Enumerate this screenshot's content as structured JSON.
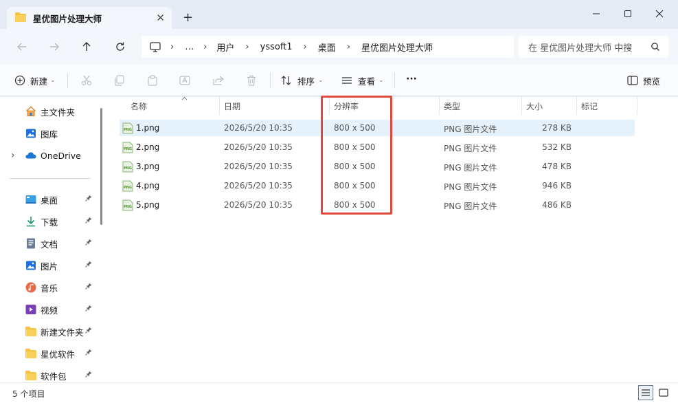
{
  "window": {
    "tab_title": "星优图片处理大师",
    "tab_close": "✕",
    "new_tab": "+"
  },
  "address": {
    "crumbs": [
      "…",
      "用户",
      "yssoft1",
      "桌面",
      "星优图片处理大师"
    ],
    "separator": "›"
  },
  "search": {
    "placeholder": "在 星优图片处理大师 中搜"
  },
  "toolbar": {
    "new_label": "新建",
    "sort_label": "排序",
    "view_label": "查看",
    "more_label": "···",
    "preview_label": "预览",
    "caret": "⌄"
  },
  "sidebar": {
    "top_items": [
      {
        "label": "主文件夹",
        "icon": "home-icon"
      },
      {
        "label": "图库",
        "icon": "gallery-icon"
      },
      {
        "label": "OneDrive",
        "icon": "onedrive-icon"
      }
    ],
    "pinned_items": [
      {
        "label": "桌面",
        "icon": "desktop-icon"
      },
      {
        "label": "下载",
        "icon": "download-icon"
      },
      {
        "label": "文档",
        "icon": "document-icon"
      },
      {
        "label": "图片",
        "icon": "pictures-icon"
      },
      {
        "label": "音乐",
        "icon": "music-icon"
      },
      {
        "label": "视频",
        "icon": "video-icon"
      },
      {
        "label": "新建文件夹",
        "icon": "folder-icon"
      },
      {
        "label": "星优软件",
        "icon": "folder-icon"
      },
      {
        "label": "软件包",
        "icon": "folder-icon"
      }
    ],
    "expand_glyph": "›",
    "pin_glyph": "📌"
  },
  "columns": {
    "name": "名称",
    "date": "日期",
    "resolution": "分辨率",
    "type": "类型",
    "size": "大小",
    "tags": "标记"
  },
  "files": [
    {
      "name": "1.png",
      "date": "2026/5/20 10:35",
      "resolution": "800 x 500",
      "type": "PNG 图片文件",
      "size": "278 KB"
    },
    {
      "name": "2.png",
      "date": "2026/5/20 10:35",
      "resolution": "800 x 500",
      "type": "PNG 图片文件",
      "size": "532 KB"
    },
    {
      "name": "3.png",
      "date": "2026/5/20 10:35",
      "resolution": "800 x 500",
      "type": "PNG 图片文件",
      "size": "478 KB"
    },
    {
      "name": "4.png",
      "date": "2026/5/20 10:35",
      "resolution": "800 x 500",
      "type": "PNG 图片文件",
      "size": "946 KB"
    },
    {
      "name": "5.png",
      "date": "2026/5/20 10:35",
      "resolution": "800 x 500",
      "type": "PNG 图片文件",
      "size": "486 KB"
    }
  ],
  "status": {
    "item_count": "5 个项目"
  },
  "colors": {
    "highlight_box": "#e04a3f",
    "selected_row": "#e5f1fb",
    "folder": "#f5c242"
  }
}
